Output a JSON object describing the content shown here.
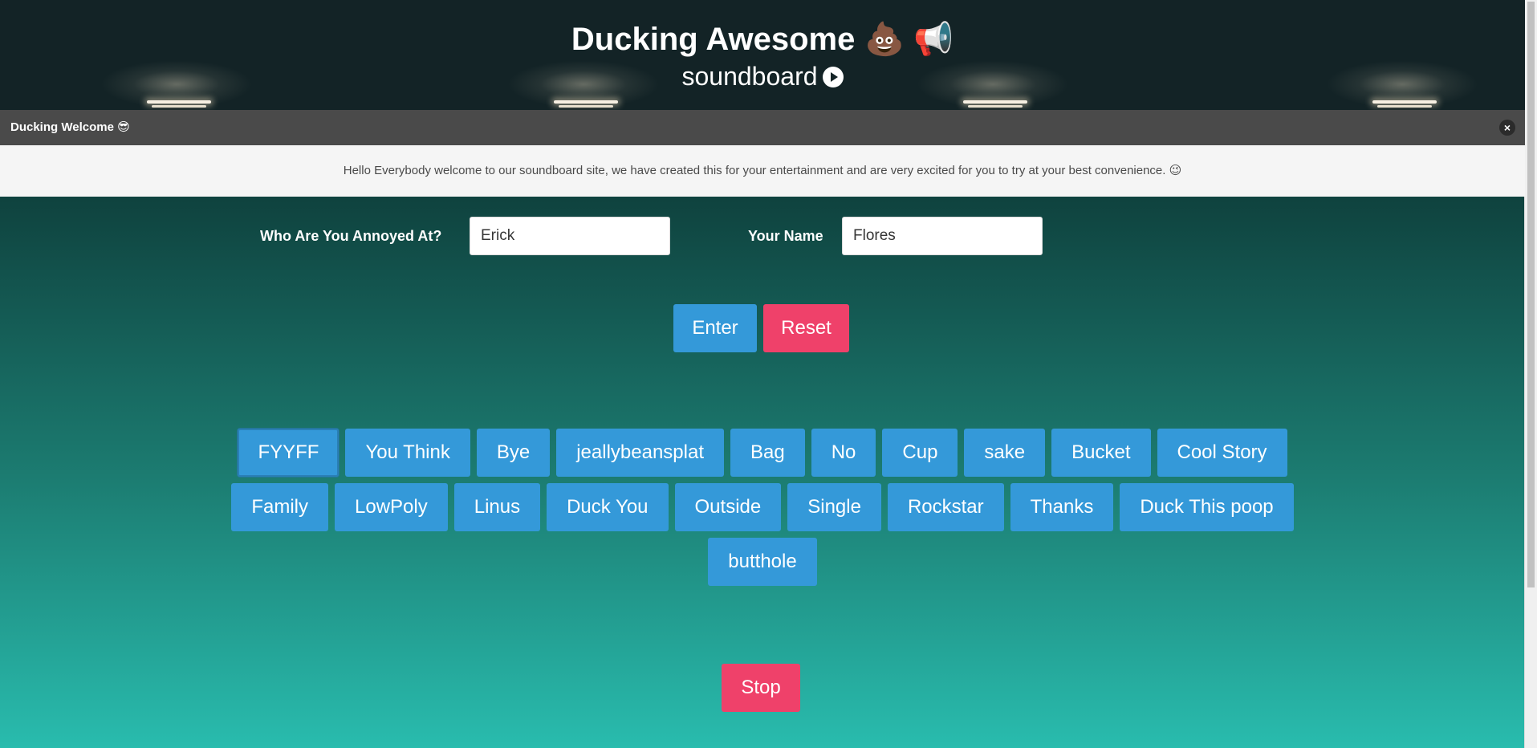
{
  "header": {
    "title": "Ducking Awesome",
    "title_icons": "💩 📢",
    "subtitle": "soundboard"
  },
  "notice": {
    "title": "Ducking Welcome 😎",
    "close_label": "×",
    "message": "Hello Everybody welcome to our soundboard site, we have created this for your entertainment and are very excited for you to try at your best convenience. 😉"
  },
  "form": {
    "annoyed_label": "Who Are You Annoyed At?",
    "annoyed_value": "Erick",
    "name_label": "Your Name",
    "name_value": "Flores",
    "enter_label": "Enter",
    "reset_label": "Reset"
  },
  "sounds": {
    "row1": [
      "FYYFF",
      "You Think",
      "Bye",
      "jeallybeansplat",
      "Bag",
      "No",
      "Cup",
      "sake",
      "Bucket",
      "Cool Story"
    ],
    "row2": [
      "Family",
      "LowPoly",
      "Linus",
      "Duck You",
      "Outside",
      "Single",
      "Rockstar",
      "Thanks",
      "Duck This poop"
    ],
    "row3": [
      "butthole"
    ]
  },
  "stop_label": "Stop",
  "colors": {
    "primary": "#3499d9",
    "danger": "#ef416a",
    "hero_bg": "#132326"
  }
}
